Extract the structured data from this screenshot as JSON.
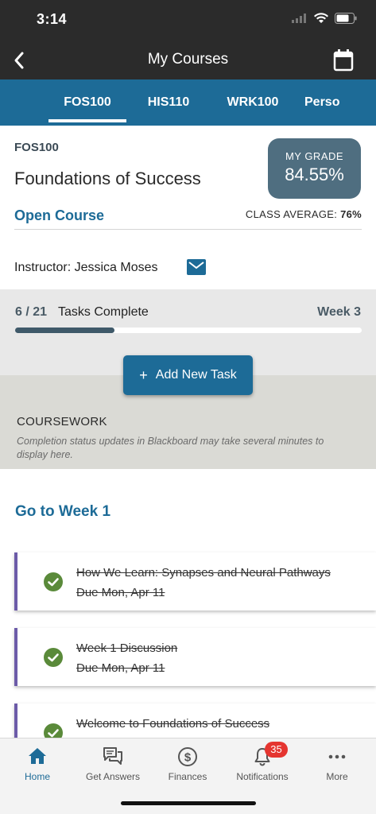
{
  "status_bar": {
    "time": "3:14"
  },
  "header": {
    "title": "My Courses"
  },
  "tabs": [
    {
      "label": "FOS100",
      "active": true
    },
    {
      "label": "HIS110",
      "active": false
    },
    {
      "label": "WRK100",
      "active": false
    },
    {
      "label": "Perso",
      "active": false
    }
  ],
  "course": {
    "code": "FOS100",
    "name": "Foundations of Success",
    "open_label": "Open Course",
    "grade_label": "MY GRADE",
    "grade_value": "84.55%",
    "class_avg_label": "CLASS AVERAGE:",
    "class_avg_value": "76%",
    "instructor": "Instructor: Jessica Moses"
  },
  "progress": {
    "count": "6 / 21",
    "label": "Tasks Complete",
    "week": "Week 3",
    "completed": 6,
    "total": 21
  },
  "add_task_label": "Add New Task",
  "coursework": {
    "title": "COURSEWORK",
    "note": "Completion status updates in Blackboard may take several minutes to display here."
  },
  "go_week_label": "Go to Week 1",
  "tasks": [
    {
      "title": "How We Learn: Synapses and Neural Pathways",
      "due": "Due Mon, Apr 11"
    },
    {
      "title": "Week 1 Discussion",
      "due": "Due Mon, Apr 11"
    },
    {
      "title": "Welcome to Foundations of Success",
      "due": ""
    }
  ],
  "nav": [
    {
      "label": "Home",
      "icon": "home-icon",
      "active": true
    },
    {
      "label": "Get Answers",
      "icon": "chat-icon",
      "active": false
    },
    {
      "label": "Finances",
      "icon": "dollar-icon",
      "active": false
    },
    {
      "label": "Notifications",
      "icon": "bell-icon",
      "active": false,
      "badge": "35"
    },
    {
      "label": "More",
      "icon": "more-icon",
      "active": false
    }
  ],
  "colors": {
    "accent": "#1d6b97",
    "header_bg": "#2b2b2b",
    "grade_bg": "#4f6e80",
    "task_border": "#6c5ba8",
    "check": "#5a8a3a",
    "badge": "#e53530"
  }
}
